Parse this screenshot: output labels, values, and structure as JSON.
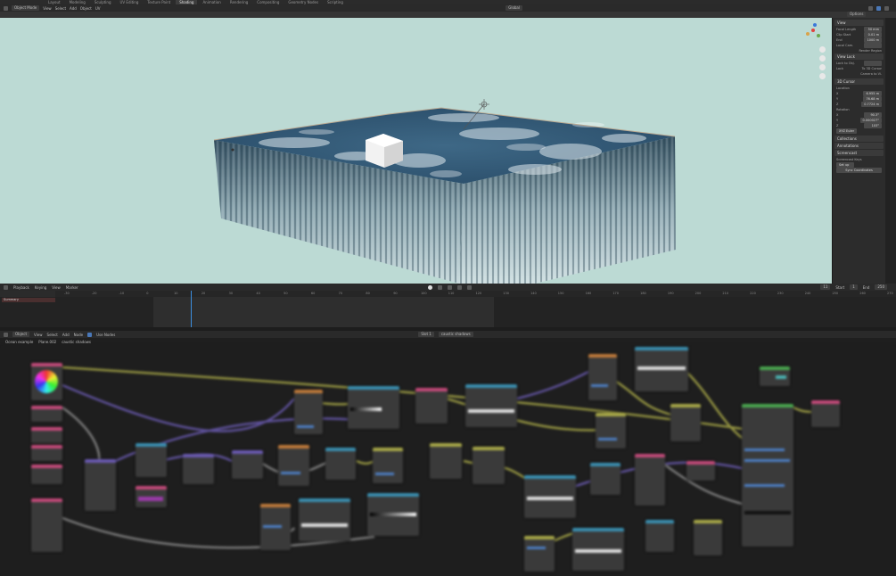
{
  "topbar": {
    "tabs": [
      "Layout",
      "Modeling",
      "Sculpting",
      "UV Editing",
      "Texture Paint",
      "Shading",
      "Animation",
      "Rendering",
      "Compositing",
      "Geometry Nodes",
      "Scripting"
    ],
    "active_tab": "Shading"
  },
  "viewport_header": {
    "mode": "Object Mode",
    "menus": [
      "View",
      "Select",
      "Add",
      "Object",
      "UV"
    ],
    "orientation": "Global",
    "options_label": "Options"
  },
  "npanel": {
    "view_header": "View",
    "focal_length_label": "Focal Length",
    "focal_length_value": "50 mm",
    "clip_start_label": "Clip Start",
    "clip_start_value": "0.01 m",
    "clip_end_label": "End",
    "clip_end_value": "1000 m",
    "local_camera_label": "Local Cam.",
    "render_region_label": "Render Region",
    "view_lock_header": "View Lock",
    "lock_to_object_label": "Lock to Obj.",
    "lock_label": "Lock",
    "to_3d_cursor_label": "To 3D Cursor",
    "camera_to_view_label": "Camera to Vi.",
    "cursor_header": "3D Cursor",
    "location_label": "Location",
    "loc_x_label": "X",
    "loc_x": "6.955 m",
    "loc_y_label": "Y",
    "loc_y": "76.68 m",
    "loc_z_label": "Z",
    "loc_z": "0.7724 m",
    "rotation_label": "Rotation",
    "rot_x_label": "X",
    "rot_x": "90.3°",
    "rot_y_label": "Y",
    "rot_y": "0.000027°",
    "rot_z_label": "Z",
    "rot_z": "103°",
    "rot_mode": "XYZ Euler",
    "collections_header": "Collections",
    "annotations_header": "Annotations",
    "screencast_header": "Screencast",
    "screencast_label": "Screencast Keys",
    "screencast_row": "Set up",
    "sync_label": "Sync Coordinates"
  },
  "timeline": {
    "menus": [
      "Playback",
      "Keying",
      "View",
      "Marker"
    ],
    "summary_label": "Summary",
    "current_frame": "11",
    "start_label": "Start",
    "start_value": "1",
    "end_label": "End",
    "end_value": "250",
    "ruler_ticks": [
      "-30",
      "-20",
      "-10",
      "0",
      "10",
      "20",
      "30",
      "40",
      "50",
      "60",
      "70",
      "80",
      "90",
      "100",
      "110",
      "120",
      "130",
      "140",
      "150",
      "160",
      "170",
      "180",
      "190",
      "200",
      "210",
      "220",
      "230",
      "240",
      "250",
      "260",
      "270"
    ]
  },
  "node_editor": {
    "type": "Object",
    "menus": [
      "View",
      "Select",
      "Add",
      "Node"
    ],
    "use_nodes_label": "Use Nodes",
    "slot": "Slot 1",
    "material": "caustic shadows",
    "breadcrumb": [
      "Ocean example",
      "Plane.002",
      "caustic shadows"
    ]
  },
  "colors": {
    "viewport_bg": "#bcdad4",
    "ocean_top": "#2f5777",
    "ocean_side": "#5d7d8a",
    "accent_blue": "#3c8ee0"
  }
}
